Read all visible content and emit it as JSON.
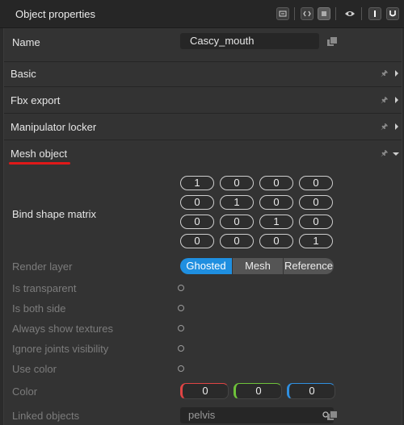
{
  "window": {
    "title": "Object properties"
  },
  "toolbar_icons": [
    "panel-icon",
    "code-icon",
    "list-icon",
    "eye-icon",
    "italic-i-icon",
    "underline-u-icon"
  ],
  "name_row": {
    "label": "Name",
    "value": "Cascy_mouth"
  },
  "sections": [
    {
      "label": "Basic",
      "expanded": false
    },
    {
      "label": "Fbx export",
      "expanded": false
    },
    {
      "label": "Manipulator locker",
      "expanded": false
    },
    {
      "label": "Mesh object",
      "expanded": true
    }
  ],
  "mesh": {
    "bind_shape_label": "Bind shape matrix",
    "matrix": [
      [
        "1",
        "0",
        "0",
        "0"
      ],
      [
        "0",
        "1",
        "0",
        "0"
      ],
      [
        "0",
        "0",
        "1",
        "0"
      ],
      [
        "0",
        "0",
        "0",
        "1"
      ]
    ],
    "render_layer": {
      "label": "Render layer",
      "options": [
        "Ghosted",
        "Mesh",
        "Reference"
      ],
      "selected": "Ghosted"
    },
    "flags": [
      {
        "label": "Is transparent"
      },
      {
        "label": "Is both side"
      },
      {
        "label": "Always show textures"
      },
      {
        "label": "Ignore joints visibility"
      },
      {
        "label": "Use color"
      }
    ],
    "color": {
      "label": "Color",
      "r": "0",
      "g": "0",
      "b": "0"
    },
    "linked": {
      "label": "Linked objects",
      "value": "pelvis"
    }
  },
  "colors": {
    "accent": "#1f8fe0",
    "annotation_underline": "#e01919"
  }
}
